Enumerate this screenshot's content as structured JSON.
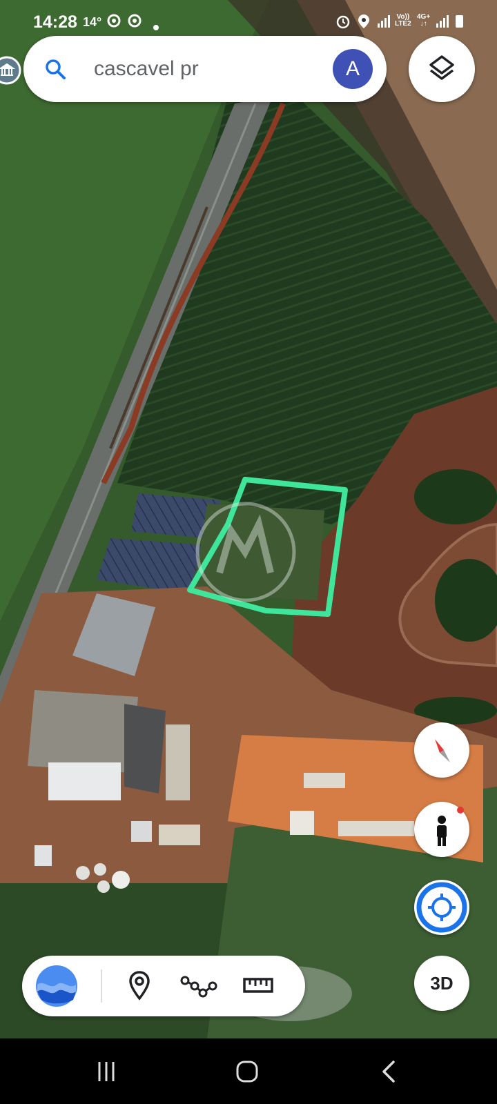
{
  "status_bar": {
    "time": "14:28",
    "temperature": "14°",
    "network_label_top": "Vo))",
    "network_label_bottom": "LTE2",
    "network_type": "4G+",
    "icons": [
      "chrome-icon",
      "chrome-icon",
      "dot-icon",
      "alarm-icon",
      "location-icon",
      "signal-icon",
      "battery-icon"
    ]
  },
  "search": {
    "query": "cascavel pr",
    "avatar_letter": "A",
    "avatar_color": "#3f51b5"
  },
  "map_controls": {
    "layers_icon": "layers-icon",
    "compass_icon": "compass-icon",
    "pegman_icon": "pegman-icon",
    "locate_icon": "my-location-icon",
    "btn_3d_label": "3D"
  },
  "toolbar": {
    "items": [
      "earth-wave-icon",
      "place-pin-icon",
      "path-icon",
      "measure-ruler-icon"
    ]
  },
  "map": {
    "outline_color": "#3ee59a",
    "type": "satellite"
  },
  "nav_bar": {
    "items": [
      "recents-icon",
      "home-icon",
      "back-icon"
    ]
  }
}
